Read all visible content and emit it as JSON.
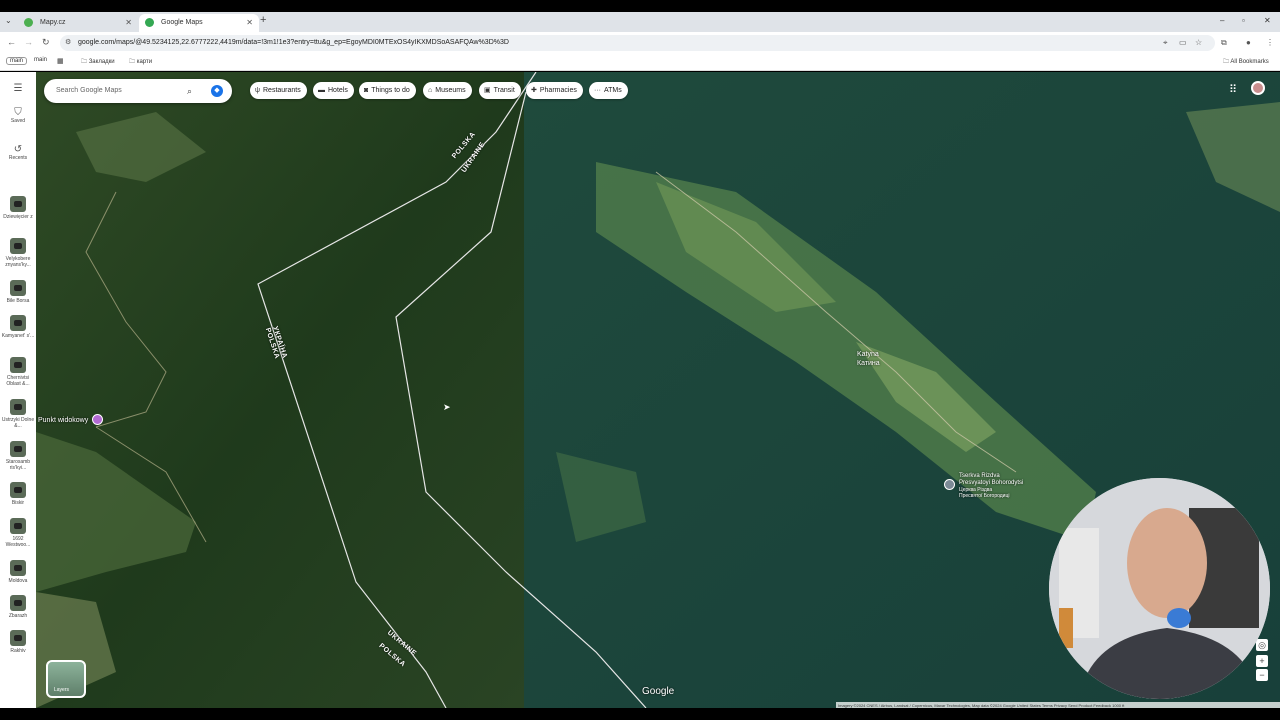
{
  "browser": {
    "tabs": [
      {
        "title": "Mapy.cz",
        "active": false,
        "favicon_color": "#4caf50"
      },
      {
        "title": "Google Maps",
        "active": true,
        "favicon_color": "#34a853"
      }
    ],
    "new_tab": "+",
    "url": "google.com/maps/@49.5234125,22.6777222,4419m/data=!3m1!1e3?entry=ttu&g_ep=EgoyMDI0MTExOS4yIKXMDSoASAFQAw%3D%3D",
    "bookmarks": [
      "main",
      "main",
      "Закладки",
      "карти"
    ],
    "all_bookmarks": "All Bookmarks"
  },
  "rail": {
    "menu_icon": "menu-icon",
    "items": [
      {
        "label": "Saved",
        "icon": "bookmark-icon"
      },
      {
        "label": "Recents",
        "icon": "history-icon"
      }
    ],
    "places": [
      "Dziewięcier z",
      "Velykobere znyans'ky...",
      "Bile Borsa",
      "Kamyanet' s'...",
      "Chernivtsi Oblast &...",
      "Ustrzyki Dolne &...",
      "Starosamb ris'kyi...",
      "Biskir",
      "1692 Westwoo...",
      "Moldova",
      "Zbarazh",
      "Rakhiv"
    ]
  },
  "search": {
    "placeholder": "Search Google Maps"
  },
  "chips": [
    {
      "label": "Restaurants",
      "icon": "fork-knife-icon"
    },
    {
      "label": "Hotels",
      "icon": "bed-icon"
    },
    {
      "label": "Things to do",
      "icon": "camera-icon"
    },
    {
      "label": "Museums",
      "icon": "museum-icon"
    },
    {
      "label": "Transit",
      "icon": "bus-icon"
    },
    {
      "label": "Pharmacies",
      "icon": "pharmacy-icon"
    },
    {
      "label": "ATMs",
      "icon": "more-icon"
    }
  ],
  "map_labels": {
    "border_top_pl": "POLSKA",
    "border_top_ua": "UKRAINE",
    "border_mid_ua": "УКРАЇНА",
    "border_mid_pl": "POLSKA",
    "border_bottom_ua": "UKRAINE",
    "border_bottom_pl": "POLSKA",
    "punkt": "Punkt widokowy",
    "village_latin": "Katyna",
    "village_cyr": "Катина",
    "church_line1": "Tserkva Rizdva",
    "church_line2": "Presvyatoyi Bohorodytsi",
    "church_line3": "Церква Різдва",
    "church_line4": "Пресвятої Богородиці"
  },
  "layers": {
    "label": "Layers"
  },
  "google": "Google",
  "attribution": "Imagery ©2024 CNES / Airbus, Landsat / Copernicus, Maxar Technologies, Map data ©2024 Google   United States   Terms   Privacy   Send Product Feedback   1000 ft"
}
